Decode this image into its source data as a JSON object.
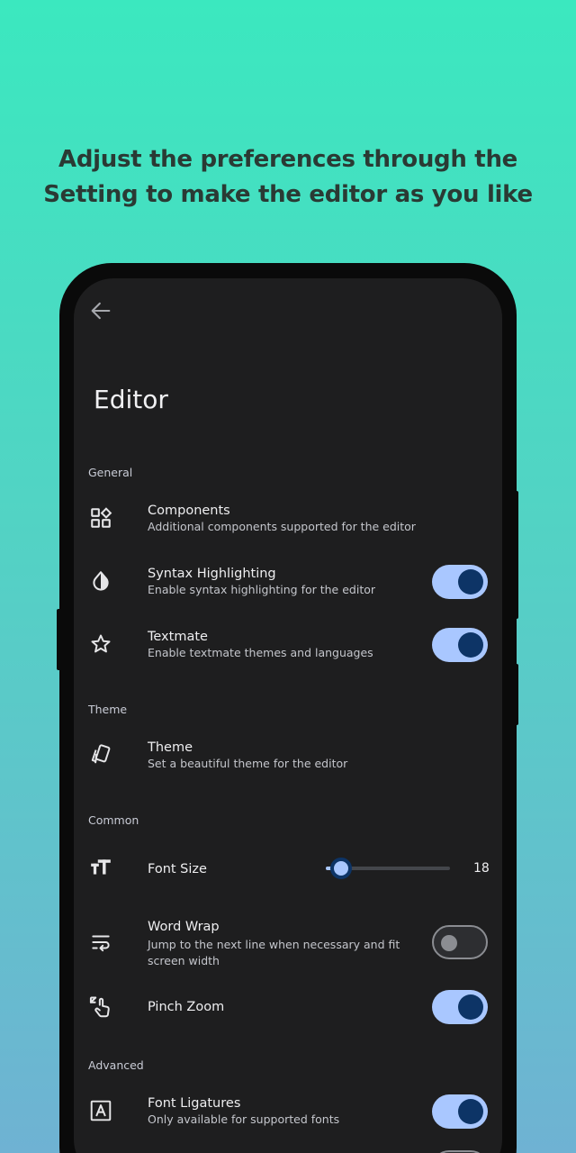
{
  "headline": {
    "line1": "Adjust the preferences through the",
    "line2": "Setting to make the editor as you like"
  },
  "screen": {
    "title": "Editor",
    "sections": {
      "general": "General",
      "theme": "Theme",
      "common": "Common",
      "advanced": "Advanced"
    },
    "items": {
      "components": {
        "title": "Components",
        "subtitle": "Additional components supported for the editor",
        "icon": "widgets-icon"
      },
      "syntax": {
        "title": "Syntax Highlighting",
        "subtitle": "Enable syntax highlighting for the editor",
        "icon": "contrast-drop-icon",
        "enabled": true
      },
      "textmate": {
        "title": "Textmate",
        "subtitle": "Enable textmate themes and languages",
        "icon": "star-icon",
        "enabled": true
      },
      "theme": {
        "title": "Theme",
        "subtitle": "Set a beautiful theme for the editor",
        "icon": "palette-cards-icon"
      },
      "font_size": {
        "title": "Font Size",
        "value": "18",
        "slider_fraction": 0.12,
        "icon": "text-size-icon"
      },
      "word_wrap": {
        "title": "Word Wrap",
        "subtitle": "Jump to the next line when necessary and fit screen width",
        "icon": "wrap-text-icon",
        "enabled": false
      },
      "pinch_zoom": {
        "title": "Pinch Zoom",
        "icon": "pinch-gesture-icon",
        "enabled": true
      },
      "ligatures": {
        "title": "Font Ligatures",
        "subtitle": "Only available for supported fonts",
        "icon": "font-box-icon",
        "enabled": true
      }
    }
  },
  "colors": {
    "switch_on_track": "#a9c7ff",
    "switch_on_knob": "#0d3466",
    "screen_bg": "#1e1e1f"
  }
}
